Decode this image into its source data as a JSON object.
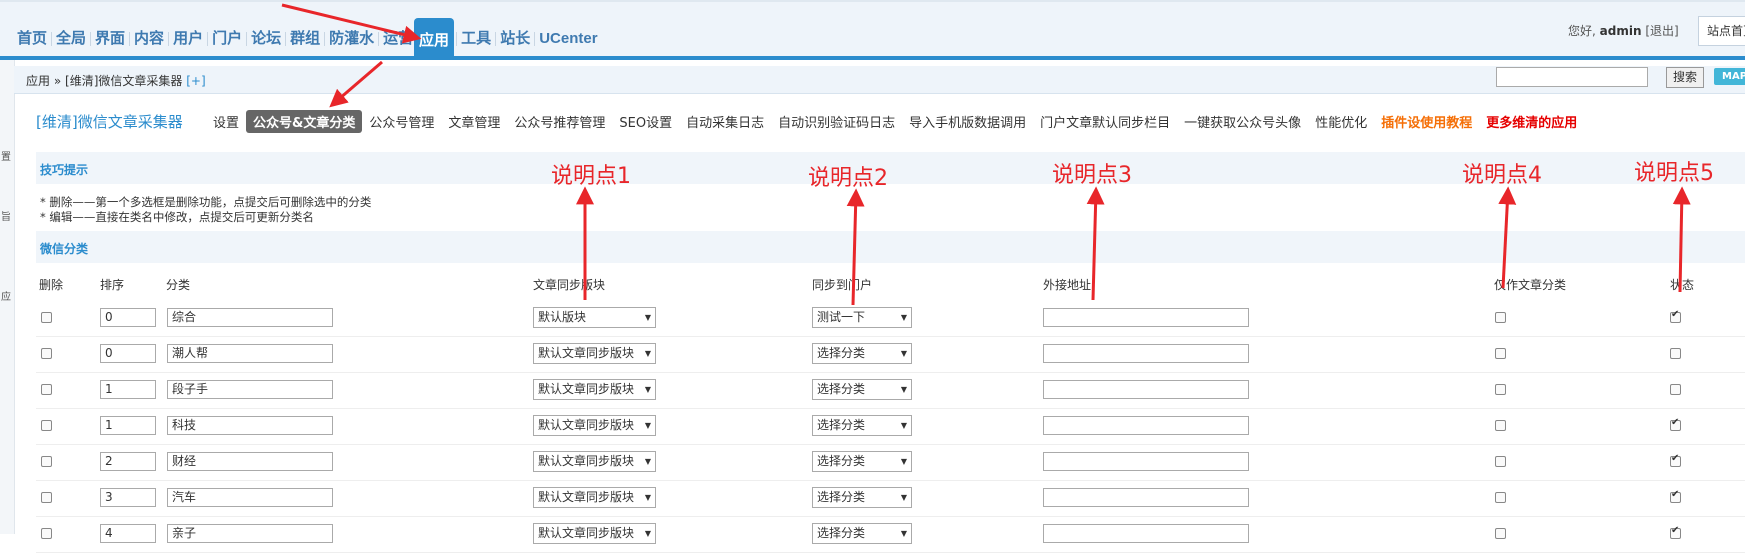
{
  "nav": {
    "items": [
      "首页",
      "全局",
      "界面",
      "内容",
      "用户",
      "门户",
      "论坛",
      "群组",
      "防灌水",
      "运营",
      "应用",
      "工具",
      "站长",
      "UCenter"
    ],
    "active": "应用"
  },
  "user": {
    "greeting": "您好,",
    "name": "admin",
    "logout": "[退出]",
    "site_home": "站点首页"
  },
  "breadcrumb": {
    "root": "应用",
    "sep": "»",
    "current": "[维清]微信文章采集器",
    "add": "[+]"
  },
  "search": {
    "button": "搜索",
    "map": "MAP"
  },
  "leftbar": [
    "置",
    "旨",
    "应"
  ],
  "plugin": {
    "title": "[维清]微信文章采集器",
    "tabs": [
      "设置",
      "公众号&文章分类",
      "公众号管理",
      "文章管理",
      "公众号推荐管理",
      "SEO设置",
      "自动采集日志",
      "自动识别验证码日志",
      "导入手机版数据调用",
      "门户文章默认同步栏目",
      "一键获取公众号头像",
      "性能优化",
      "插件设使用教程",
      "更多维清的应用"
    ],
    "active_tab": "公众号&文章分类"
  },
  "tips": {
    "title": "技巧提示",
    "lines": [
      "* 删除——第一个多选框是删除功能，点提交后可删除选中的分类",
      "* 编辑——直接在类名中修改，点提交后可更新分类名"
    ]
  },
  "category_section": {
    "title": "微信分类"
  },
  "annotations": [
    "说明点1",
    "说明点2",
    "说明点3",
    "说明点4",
    "说明点5"
  ],
  "columns": {
    "delete": "删除",
    "order": "排序",
    "category": "分类",
    "sync_block": "文章同步版块",
    "sync_portal": "同步到门户",
    "ext_url": "外接地址",
    "only_article": "仅作文章分类",
    "status": "状态"
  },
  "rows": [
    {
      "order": "0",
      "name": "综合",
      "block": "默认版块",
      "portal": "测试一下",
      "url": "",
      "only": false,
      "status": true
    },
    {
      "order": "0",
      "name": "潮人帮",
      "block": "默认文章同步版块",
      "portal": "选择分类",
      "url": "",
      "only": false,
      "status": false
    },
    {
      "order": "1",
      "name": "段子手",
      "block": "默认文章同步版块",
      "portal": "选择分类",
      "url": "",
      "only": false,
      "status": false
    },
    {
      "order": "1",
      "name": "科技",
      "block": "默认文章同步版块",
      "portal": "选择分类",
      "url": "",
      "only": false,
      "status": true
    },
    {
      "order": "2",
      "name": "财经",
      "block": "默认文章同步版块",
      "portal": "选择分类",
      "url": "",
      "only": false,
      "status": true
    },
    {
      "order": "3",
      "name": "汽车",
      "block": "默认文章同步版块",
      "portal": "选择分类",
      "url": "",
      "only": false,
      "status": true
    },
    {
      "order": "4",
      "name": "亲子",
      "block": "默认文章同步版块",
      "portal": "选择分类",
      "url": "",
      "only": false,
      "status": true
    }
  ],
  "colors": {
    "accent": "#2b8ccd",
    "annotation": "#e8262a",
    "orange_link": "#f56f07",
    "red_link": "#e60000"
  }
}
